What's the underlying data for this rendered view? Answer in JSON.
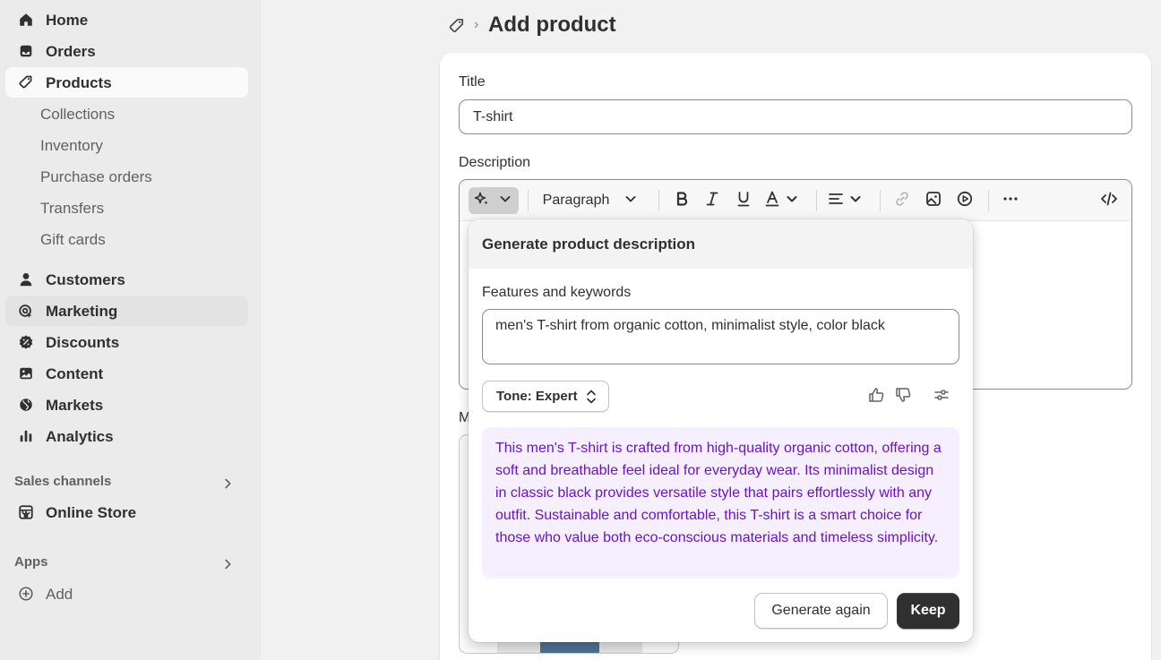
{
  "sidebar": {
    "items": [
      {
        "label": "Home",
        "icon": "home-icon"
      },
      {
        "label": "Orders",
        "icon": "inbox-icon"
      },
      {
        "label": "Products",
        "icon": "tag-icon"
      },
      {
        "label": "Customers",
        "icon": "person-icon"
      },
      {
        "label": "Marketing",
        "icon": "target-icon"
      },
      {
        "label": "Discounts",
        "icon": "discount-icon"
      },
      {
        "label": "Content",
        "icon": "image-icon"
      },
      {
        "label": "Markets",
        "icon": "globe-icon"
      },
      {
        "label": "Analytics",
        "icon": "bar-chart-icon"
      }
    ],
    "product_sub": [
      "Collections",
      "Inventory",
      "Purchase orders",
      "Transfers",
      "Gift cards"
    ],
    "sales_channels": {
      "heading": "Sales channels",
      "online_store": "Online Store"
    },
    "apps": {
      "heading": "Apps",
      "add": "Add"
    }
  },
  "header": {
    "title": "Add product"
  },
  "form": {
    "title_label": "Title",
    "title_value": "T-shirt",
    "description_label": "Description",
    "media_label": "M"
  },
  "toolbar": {
    "paragraph": "Paragraph"
  },
  "popover": {
    "title": "Generate product description",
    "keywords_label": "Features and keywords",
    "keywords_value": "men's T-shirt from organic cotton, minimalist style, color black",
    "tone": "Tone: Expert",
    "result": "This men's T-shirt is crafted from high-quality organic cotton, offering a soft and breathable feel ideal for everyday wear. Its minimalist design in classic black provides versatile style that pairs effortlessly with any outfit. Sustainable and comfortable, this T-shirt is a smart choice for those who value both eco-conscious materials and timeless simplicity.",
    "generate_again": "Generate again",
    "keep": "Keep"
  },
  "colors": {
    "accent_text": "#6a14c4",
    "accent_bg": "#f6efff",
    "primary_button": "#303030"
  }
}
